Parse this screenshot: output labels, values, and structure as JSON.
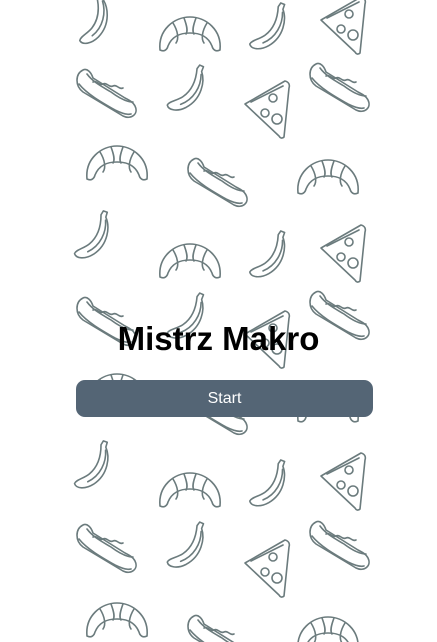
{
  "app": {
    "title": "Mistrz Makro"
  },
  "actions": {
    "start_label": "Start"
  },
  "background": {
    "pattern_icons": [
      "banana-icon",
      "croissant-icon",
      "hotdog-icon",
      "pizza-slice-icon"
    ],
    "stroke_color": "#6b7b7d"
  },
  "colors": {
    "button_background": "#546575",
    "button_text": "#ffffff",
    "title_text": "#000000",
    "page_background": "#ffffff"
  }
}
